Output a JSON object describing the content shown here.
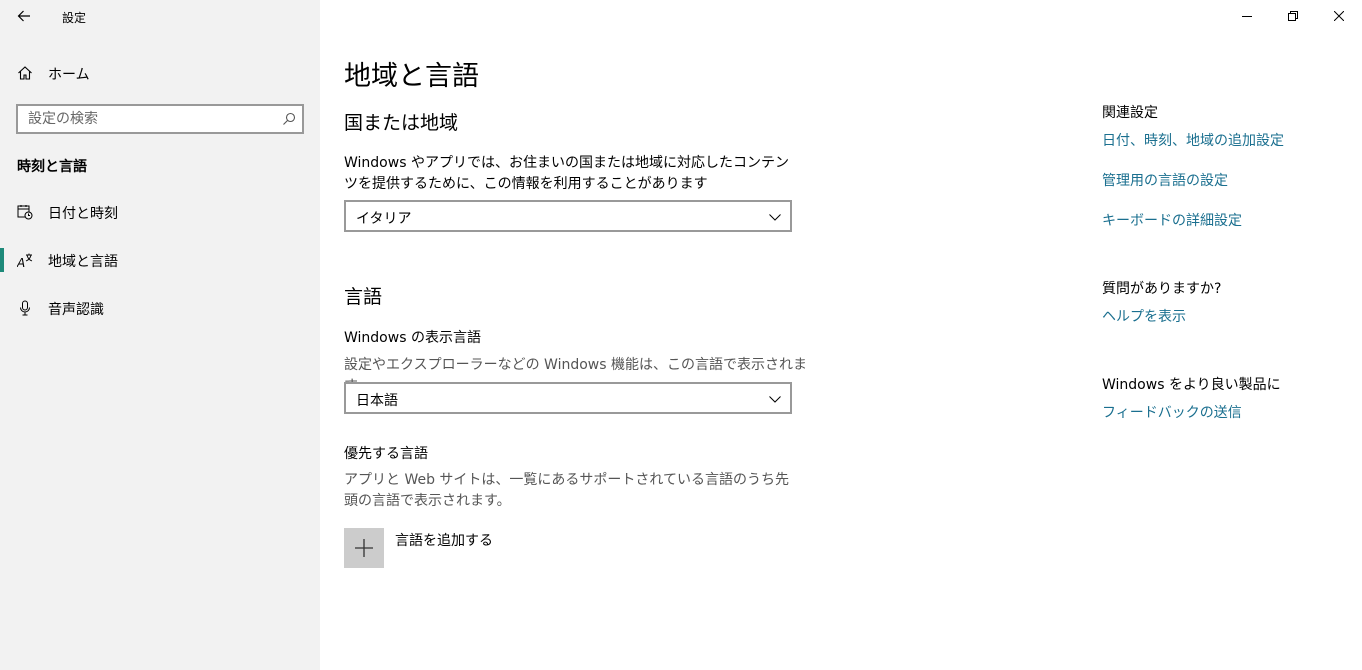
{
  "app": {
    "title": "設定",
    "back_icon": "arrow-left-icon"
  },
  "sidebar": {
    "home_label": "ホーム",
    "search_placeholder": "設定の検索",
    "category": "時刻と言語",
    "items": [
      {
        "label": "日付と時刻",
        "icon": "calendar-clock-icon",
        "selected": false
      },
      {
        "label": "地域と言語",
        "icon": "language-icon",
        "selected": true
      },
      {
        "label": "音声認識",
        "icon": "microphone-icon",
        "selected": false
      }
    ],
    "accent_color": "#1e8a7a"
  },
  "main": {
    "page_title": "地域と言語",
    "region": {
      "title": "国または地域",
      "description": "Windows やアプリでは、お住まいの国または地域に対応したコンテンツを提供するために、この情報を利用することがあります",
      "selected": "イタリア"
    },
    "language": {
      "title": "言語",
      "display_language_label": "Windows の表示言語",
      "display_language_desc": "設定やエクスプローラーなどの Windows 機能は、この言語で表示されます。",
      "display_language_value": "日本語",
      "preferred_label": "優先する言語",
      "preferred_desc": "アプリと Web サイトは、一覧にあるサポートされている言語のうち先頭の言語で表示されます。",
      "add_language_label": "言語を追加する"
    }
  },
  "related": {
    "heading": "関連設定",
    "links": [
      "日付、時刻、地域の追加設定",
      "管理用の言語の設定",
      "キーボードの詳細設定"
    ],
    "help_heading": "質問がありますか?",
    "help_link": "ヘルプを表示",
    "feedback_heading": "Windows をより良い製品に",
    "feedback_link": "フィードバックの送信",
    "link_color": "#1a6f8f"
  }
}
